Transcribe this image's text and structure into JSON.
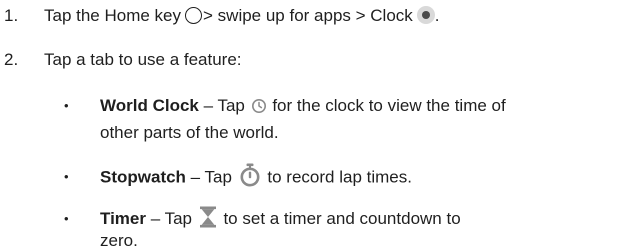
{
  "steps": [
    {
      "number": "1.",
      "text_before_home": "Tap the Home key",
      "text_after_home": "> swipe up for apps > Clock",
      "text_end": "."
    },
    {
      "number": "2.",
      "text": "Tap a tab to use a feature:"
    }
  ],
  "bullets": [
    {
      "title": "World Clock",
      "text_before_icon": " – Tap ",
      "text_after_icon": " for the clock to view the time of",
      "continuation": "other parts of the world."
    },
    {
      "title": "Stopwatch",
      "text_before_icon": " – Tap ",
      "text_after_icon": " to record lap times."
    },
    {
      "title": "Timer",
      "text_before_icon": " – Tap ",
      "text_after_icon": " to set a timer and countdown to",
      "continuation": "zero."
    }
  ],
  "bullet_symbol": "•",
  "icons": {
    "home": "home-key-icon",
    "clock_app": "clock-app-icon",
    "world_clock": "world-clock-icon",
    "stopwatch": "stopwatch-icon",
    "timer": "hourglass-icon"
  },
  "colors": {
    "text": "#1f1f1f",
    "icon_gray": "#8a8a8a",
    "icon_dark": "#4a4a4a"
  }
}
